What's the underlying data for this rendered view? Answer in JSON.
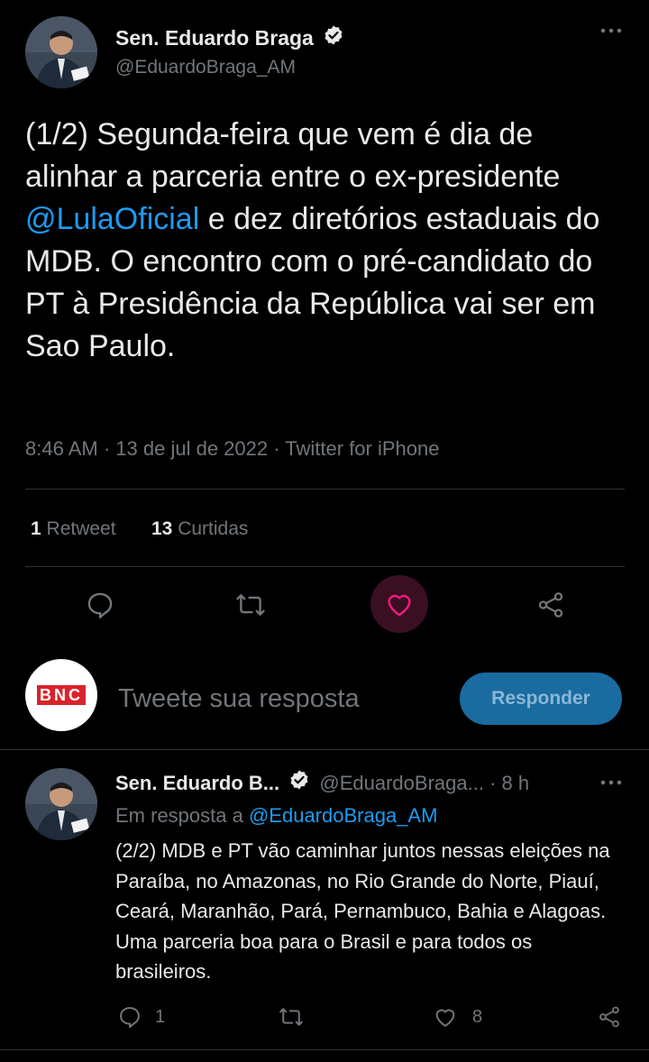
{
  "main_tweet": {
    "display_name": "Sen. Eduardo Braga",
    "handle": "@EduardoBraga_AM",
    "text_before": "(1/2) Segunda-feira que vem é dia de alinhar a parceria  entre o ex-presidente ",
    "mention": "@LulaOficial",
    "text_after": " e dez diretórios estaduais do MDB. O encontro com o pré-candidato do PT à Presidência da República vai ser em Sao Paulo.",
    "time": "8:46 AM",
    "date": "13 de jul de 2022",
    "source": "Twitter for iPhone",
    "retweet_count": "1",
    "retweet_label": "Retweet",
    "like_count": "13",
    "like_label": "Curtidas"
  },
  "reply_box": {
    "avatar_text": "BNC",
    "placeholder": "Tweete sua resposta",
    "button_label": "Responder"
  },
  "reply_tweet": {
    "display_name": "Sen. Eduardo B...",
    "handle": "@EduardoBraga...",
    "age": "8 h",
    "in_reply_prefix": "Em resposta a",
    "in_reply_handle": "@EduardoBraga_AM",
    "text": "(2/2) MDB e PT vão caminhar juntos nessas eleições na Paraíba, no Amazonas, no Rio Grande do Norte, Piauí, Ceará, Maranhão, Pará, Pernambuco, Bahia e Alagoas. Uma parceria boa para o Brasil e para todos os brasileiros.",
    "reply_count": "1",
    "like_count": "8"
  },
  "colors": {
    "background": "#000000",
    "accent": "#1d9bf0",
    "muted": "#71767b",
    "like_highlight": "#f91880",
    "button_bg": "#1a6ba0",
    "bnc_red": "#d9232a"
  },
  "icons": [
    "more-icon",
    "verified-icon",
    "reply-icon",
    "retweet-icon",
    "like-icon",
    "share-icon"
  ]
}
